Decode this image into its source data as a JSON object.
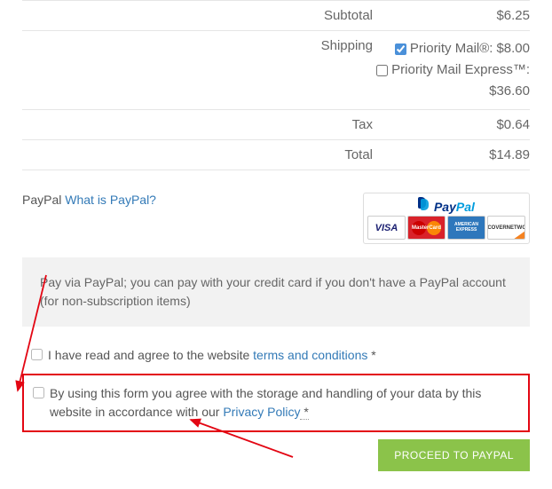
{
  "totals": {
    "subtotal_label": "Subtotal",
    "subtotal_value": "$6.25",
    "shipping_label": "Shipping",
    "shipping_options": [
      {
        "label": "Priority Mail®:",
        "price": "$8.00",
        "checked": true
      },
      {
        "label": "Priority Mail Express™:",
        "price": "$36.60",
        "checked": false
      }
    ],
    "tax_label": "Tax",
    "tax_value": "$0.64",
    "total_label": "Total",
    "total_value": "$14.89"
  },
  "paypal": {
    "name": "PayPal",
    "what_link": "What is PayPal?",
    "info": "Pay via PayPal; you can pay with your credit card if you don't have a PayPal account (for non-subscription items)",
    "logo_text_1": "Pay",
    "logo_text_2": "Pal",
    "cards": {
      "visa": "VISA",
      "mc": "MasterCard",
      "amex": "AMERICAN EXPRESS",
      "disc_top": "DISCOVER",
      "disc_bot": "NETWORK"
    }
  },
  "consent": {
    "terms_pre": "I have read and agree to the website ",
    "terms_link": "terms and conditions",
    "privacy_pre": "By using this form you agree with the storage and handling of your data by this website in accordance with our ",
    "privacy_link": "Privacy Policy",
    "star": " *"
  },
  "button": {
    "label": "PROCEED TO PAYPAL"
  }
}
